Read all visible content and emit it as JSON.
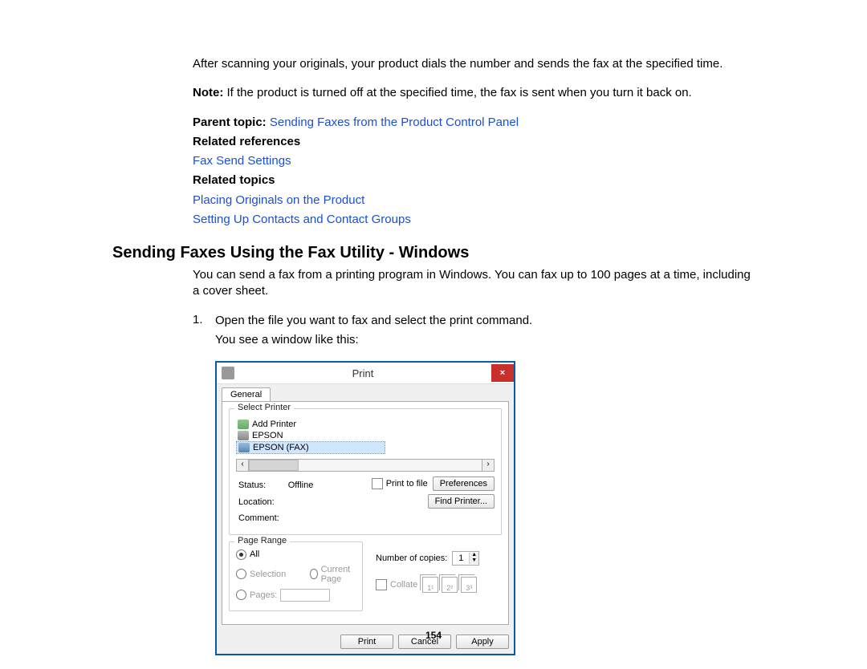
{
  "page_number": "154",
  "intro_para": "After scanning your originals, your product dials the number and sends the fax at the specified time.",
  "note_label": "Note:",
  "note_text": " If the product is turned off at the specified time, the fax is sent when you turn it back on.",
  "parent_label": "Parent topic: ",
  "parent_link": "Sending Faxes from the Product Control Panel",
  "related_refs_heading": "Related references",
  "ref_link_1": "Fax Send Settings",
  "related_topics_heading": "Related topics",
  "topic_link_1": "Placing Originals on the Product",
  "topic_link_2": "Setting Up Contacts and Contact Groups",
  "section_heading": "Sending Faxes Using the Fax Utility - Windows",
  "section_para": "You can send a fax from a printing program in Windows. You can fax up to 100 pages at a time, including a cover sheet.",
  "step_1": "Open the file you want to fax and select the print command.",
  "step_1_sub": "You see a window like this:",
  "dialog": {
    "title": "Print",
    "tab_general": "General",
    "group_select_printer": "Select Printer",
    "printers": {
      "add": "Add Printer",
      "epson": "EPSON",
      "fax": "EPSON (FAX)"
    },
    "status_label": "Status:",
    "status_value": "Offline",
    "location_label": "Location:",
    "comment_label": "Comment:",
    "print_to_file": "Print to file",
    "btn_preferences": "Preferences",
    "btn_find_printer": "Find Printer...",
    "group_page_range": "Page Range",
    "radio_all": "All",
    "radio_selection": "Selection",
    "radio_current": "Current Page",
    "radio_pages": "Pages:",
    "copies_label": "Number of copies:",
    "copies_value": "1",
    "collate_label": "Collate",
    "collate_pics": [
      "1¹",
      "2²",
      "3³"
    ],
    "btn_print": "Print",
    "btn_cancel": "Cancel",
    "btn_apply": "Apply"
  }
}
